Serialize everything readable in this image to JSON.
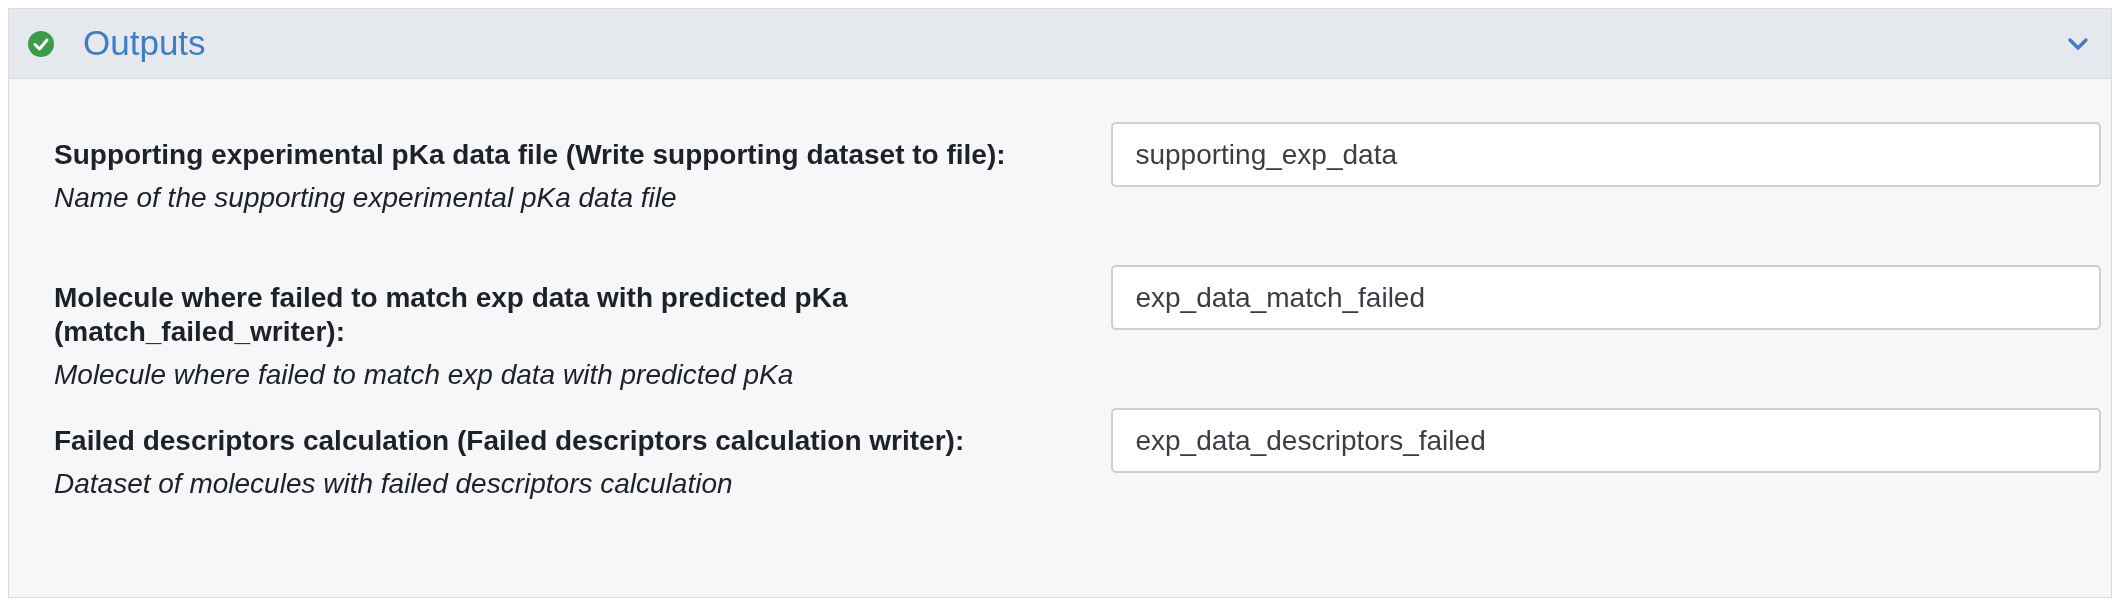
{
  "section": {
    "title": "Outputs",
    "done": true,
    "expanded": true
  },
  "outputs": [
    {
      "label": "Supporting experimental pKa data file (Write supporting dataset to file):",
      "help": "Name of the supporting experimental pKa data file",
      "value": "supporting_exp_data"
    },
    {
      "label": "Molecule where failed to match exp data with predicted pKa (match_failed_writer):",
      "help": "Molecule where failed to match exp data with predicted pKa",
      "value": "exp_data_match_failed"
    },
    {
      "label": "Failed descriptors calculation (Failed descriptors calculation writer):",
      "help": "Dataset of molecules with failed descriptors calculation",
      "value": "exp_data_descriptors_failed"
    }
  ]
}
